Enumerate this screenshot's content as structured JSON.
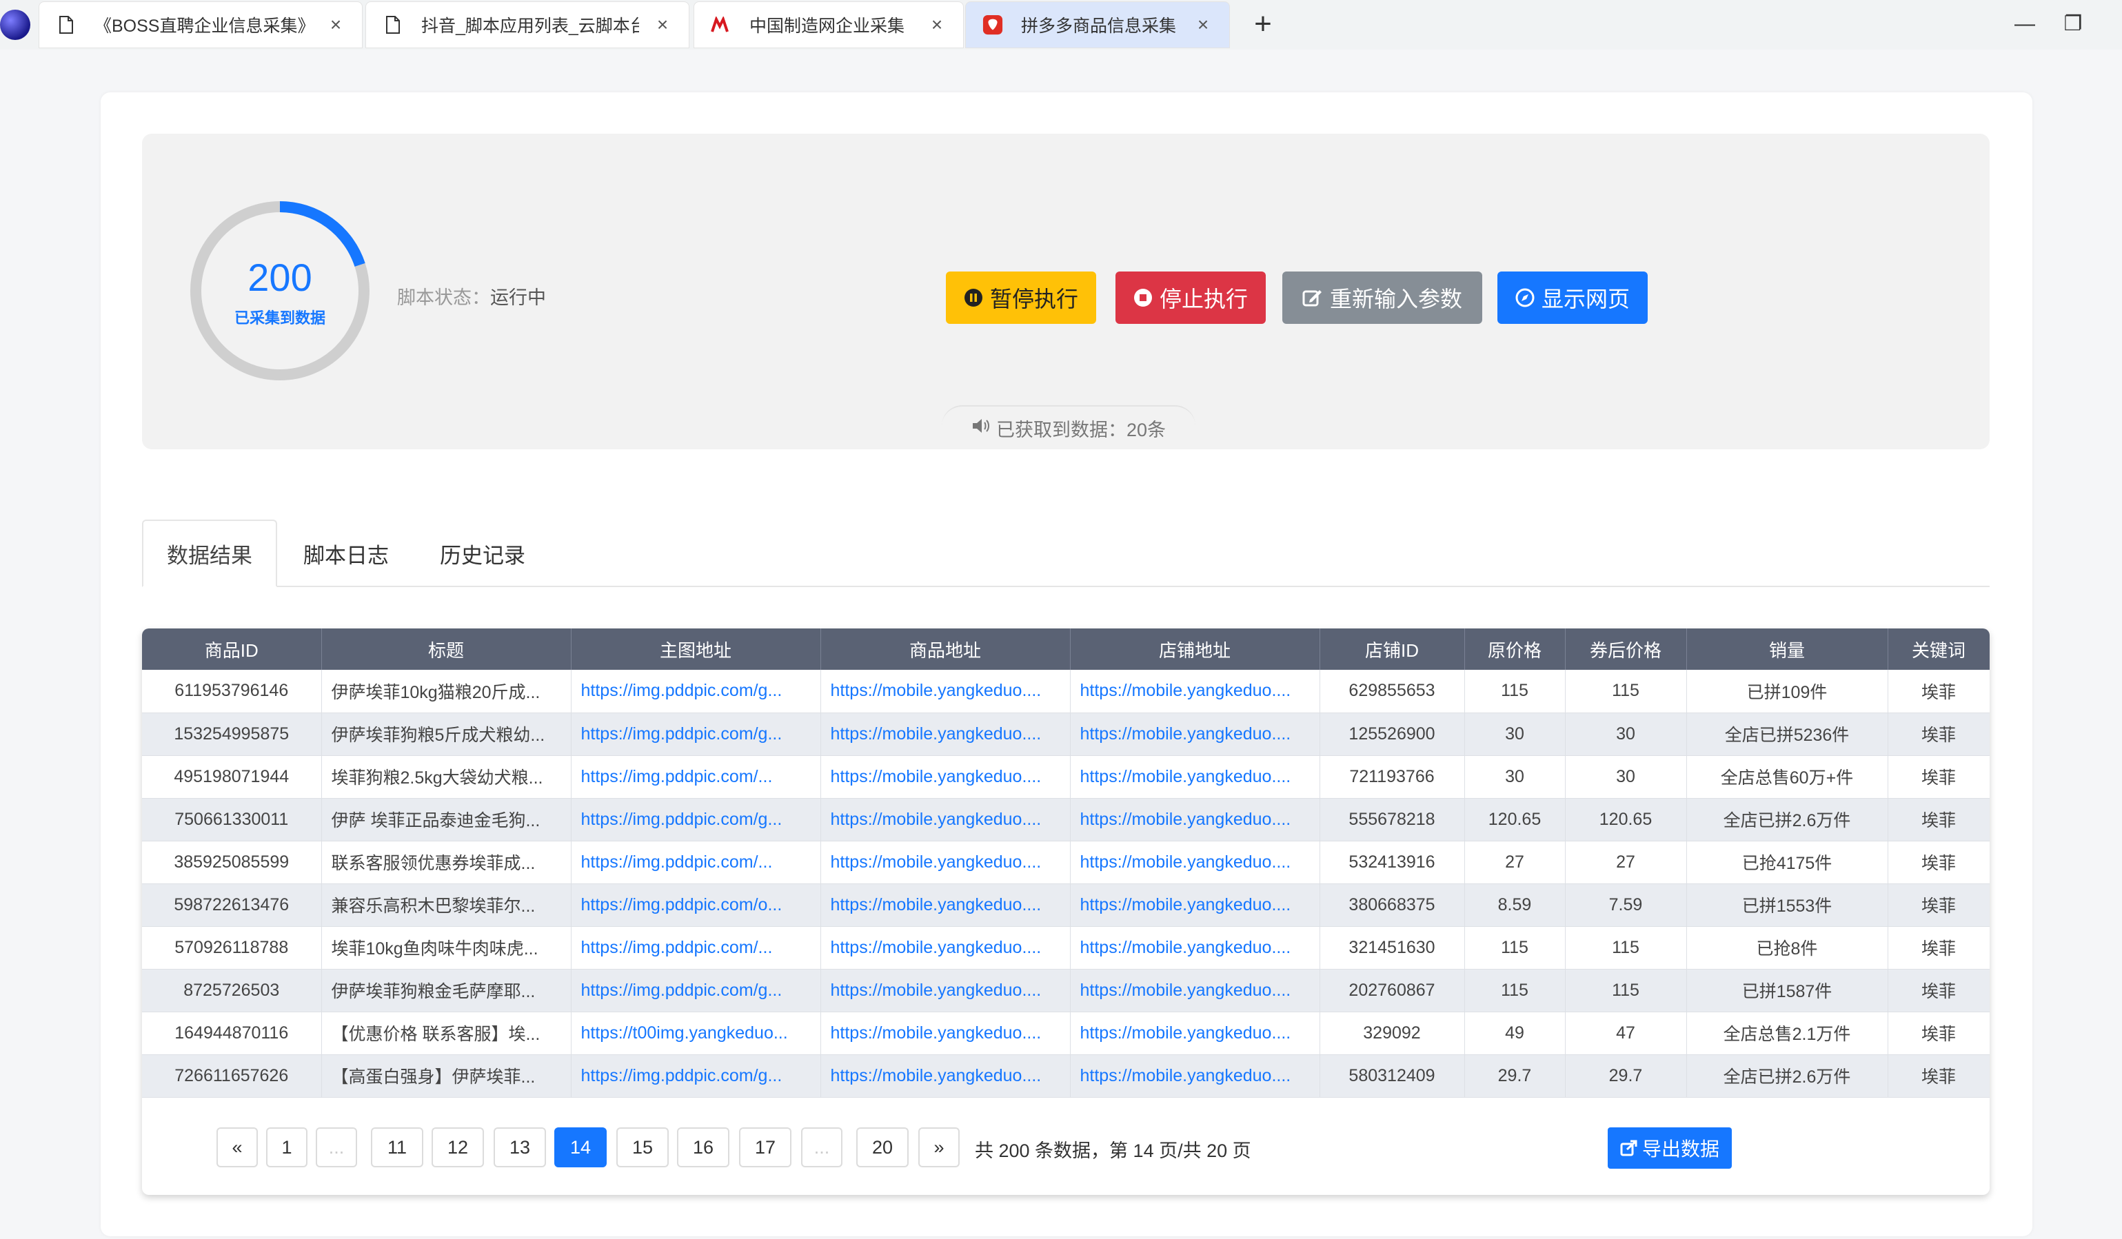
{
  "browser": {
    "tabs": [
      {
        "title": "《BOSS直聘企业信息采集》",
        "icon": "page-icon"
      },
      {
        "title": "抖音_脚本应用列表_云脚本台",
        "icon": "page-icon"
      },
      {
        "title": "中国制造网企业采集",
        "icon": "made-in-china-icon"
      },
      {
        "title": "拼多多商品信息采集",
        "icon": "pinduoduo-icon"
      }
    ],
    "new_tab": "+",
    "minimize": "—",
    "restore": "❐"
  },
  "status": {
    "count": "200",
    "count_label": "已采集到数据",
    "progress": 0.2,
    "script_status_label": "脚本状态：",
    "script_status_value": "运行中",
    "fetched": "已获取到数据：20条"
  },
  "buttons": {
    "pause": "暂停执行",
    "stop": "停止执行",
    "reinput": "重新输入参数",
    "show_page": "显示网页"
  },
  "nav_tabs": [
    "数据结果",
    "脚本日志",
    "历史记录"
  ],
  "table": {
    "headers": [
      "商品ID",
      "标题",
      "主图地址",
      "商品地址",
      "店铺地址",
      "店铺ID",
      "原价格",
      "券后价格",
      "销量",
      "关键词"
    ],
    "rows": [
      [
        "611953796146",
        "伊萨埃菲10kg猫粮20斤成...",
        "https://img.pddpic.com/g...",
        "https://mobile.yangkeduo....",
        "https://mobile.yangkeduo....",
        "629855653",
        "115",
        "115",
        "已拼109件",
        "埃菲"
      ],
      [
        "153254995875",
        "伊萨埃菲狗粮5斤成犬粮幼...",
        "https://img.pddpic.com/g...",
        "https://mobile.yangkeduo....",
        "https://mobile.yangkeduo....",
        "125526900",
        "30",
        "30",
        "全店已拼5236件",
        "埃菲"
      ],
      [
        "495198071944",
        "埃菲狗粮2.5kg大袋幼犬粮...",
        "https://img.pddpic.com/...",
        "https://mobile.yangkeduo....",
        "https://mobile.yangkeduo....",
        "721193766",
        "30",
        "30",
        "全店总售60万+件",
        "埃菲"
      ],
      [
        "750661330011",
        "伊萨 埃菲正品泰迪金毛狗...",
        "https://img.pddpic.com/g...",
        "https://mobile.yangkeduo....",
        "https://mobile.yangkeduo....",
        "555678218",
        "120.65",
        "120.65",
        "全店已拼2.6万件",
        "埃菲"
      ],
      [
        "385925085599",
        "联系客服领优惠券埃菲成...",
        "https://img.pddpic.com/...",
        "https://mobile.yangkeduo....",
        "https://mobile.yangkeduo....",
        "532413916",
        "27",
        "27",
        "已抢4175件",
        "埃菲"
      ],
      [
        "598722613476",
        "兼容乐高积木巴黎埃菲尔...",
        "https://img.pddpic.com/o...",
        "https://mobile.yangkeduo....",
        "https://mobile.yangkeduo....",
        "380668375",
        "8.59",
        "7.59",
        "已拼1553件",
        "埃菲"
      ],
      [
        "570926118788",
        "埃菲10kg鱼肉味牛肉味虎...",
        "https://img.pddpic.com/...",
        "https://mobile.yangkeduo....",
        "https://mobile.yangkeduo....",
        "321451630",
        "115",
        "115",
        "已抢8件",
        "埃菲"
      ],
      [
        "8725726503",
        "伊萨埃菲狗粮金毛萨摩耶...",
        "https://img.pddpic.com/g...",
        "https://mobile.yangkeduo....",
        "https://mobile.yangkeduo....",
        "202760867",
        "115",
        "115",
        "已拼1587件",
        "埃菲"
      ],
      [
        "164944870116",
        "【优惠价格 联系客服】埃...",
        "https://t00img.yangkeduo...",
        "https://mobile.yangkeduo....",
        "https://mobile.yangkeduo....",
        "329092",
        "49",
        "47",
        "全店总售2.1万件",
        "埃菲"
      ],
      [
        "726611657626",
        "【高蛋白强身】伊萨埃菲...",
        "https://img.pddpic.com/g...",
        "https://mobile.yangkeduo....",
        "https://mobile.yangkeduo....",
        "580312409",
        "29.7",
        "29.7",
        "全店已拼2.6万件",
        "埃菲"
      ]
    ]
  },
  "pagination": {
    "prev": "«",
    "next": "»",
    "pages": [
      "1",
      "...",
      "11",
      "12",
      "13",
      "14",
      "15",
      "16",
      "17",
      "...",
      "20"
    ],
    "current": "14",
    "info": "共 200 条数据，第 14 页/共 20 页",
    "export": "导出数据"
  },
  "colors": {
    "primary": "#1677ff",
    "warning": "#ffc107",
    "danger": "#dc3545",
    "secondary": "#868e96",
    "table_header": "#5a6274"
  }
}
